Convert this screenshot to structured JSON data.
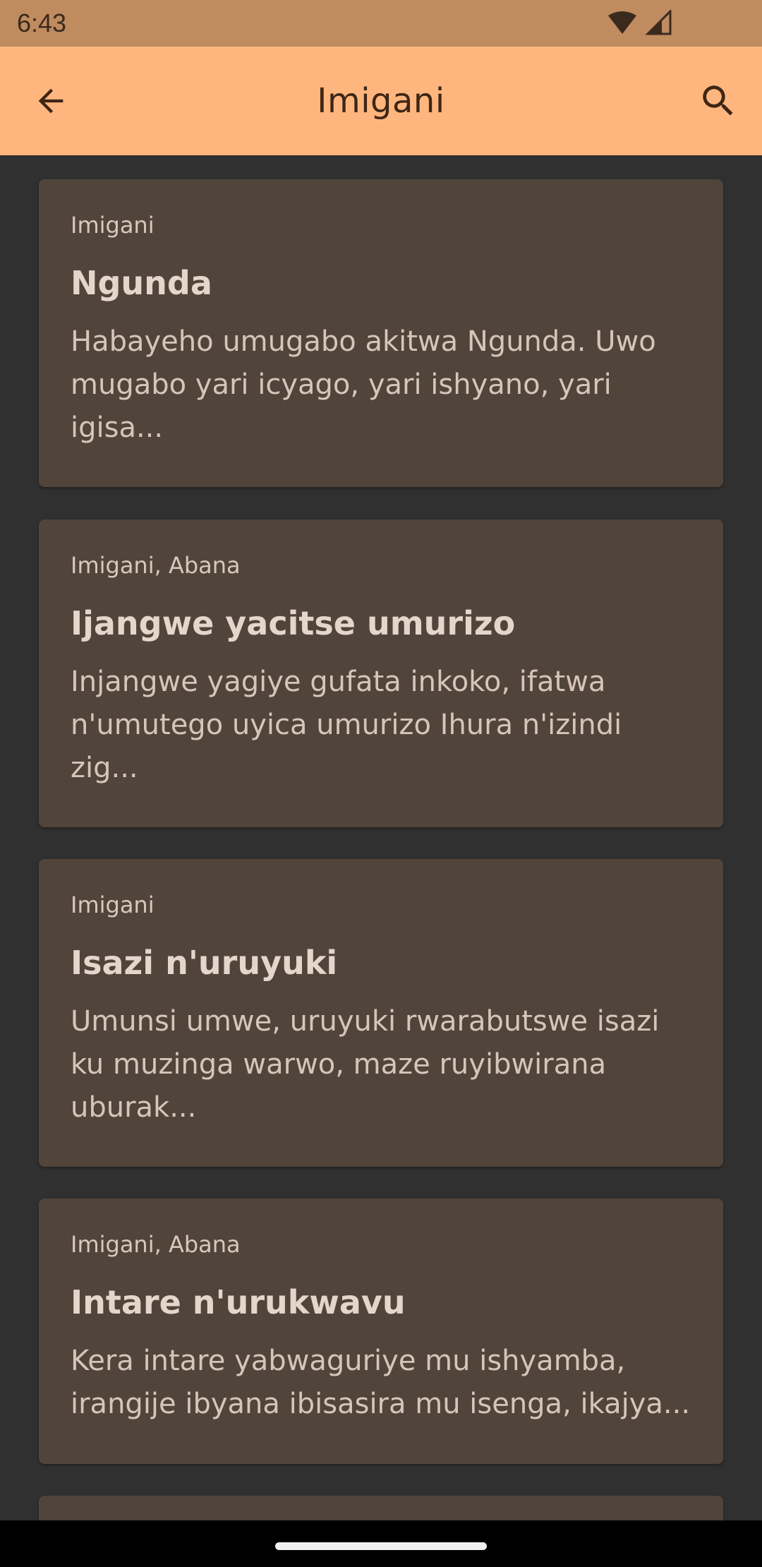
{
  "status_bar": {
    "time": "6:43"
  },
  "app_bar": {
    "title": "Imigani",
    "back_icon": "arrow-back-icon",
    "search_icon": "search-icon"
  },
  "stories": [
    {
      "category": "Imigani",
      "title": "Ngunda",
      "excerpt": "Habayeho umugabo akitwa Ngunda. Uwo mugabo yari icyago, yari ishyano, yari igisa..."
    },
    {
      "category": "Imigani, Abana",
      "title": "Ijangwe yacitse umurizo",
      "excerpt": "Injangwe yagiye gufata inkoko, ifatwa n'umutego uyica umurizo Ihura n'izindi zig..."
    },
    {
      "category": "Imigani",
      "title": "Isazi n'uruyuki",
      "excerpt": "Umunsi umwe, uruyuki rwarabutswe isazi ku muzinga warwo, maze ruyibwirana uburak..."
    },
    {
      "category": "Imigani, Abana",
      "title": "Intare n'urukwavu",
      "excerpt": "Kera intare yabwaguriye mu ishyamba, irangije ibyana ibisasira mu isenga, ikajya..."
    }
  ],
  "colors": {
    "status_bar": "#bf8b5f",
    "app_bar": "#ffb67e",
    "background": "#303030",
    "card": "#51443b"
  }
}
